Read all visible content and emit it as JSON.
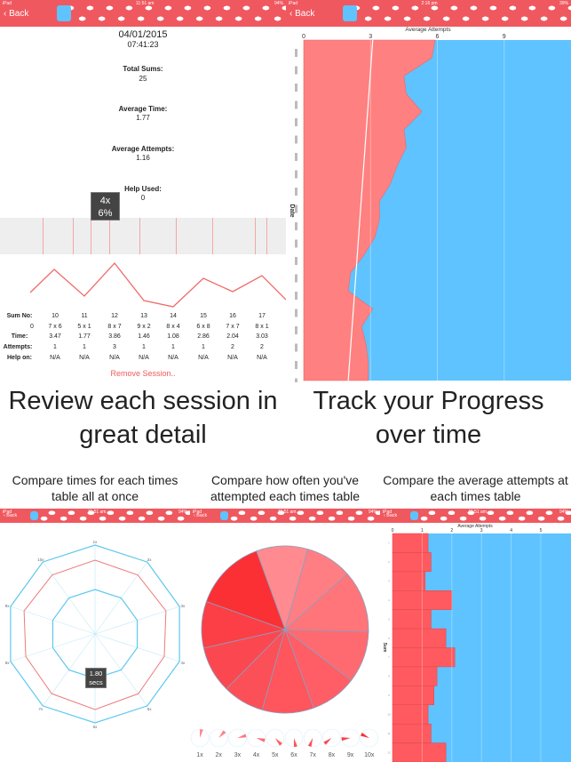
{
  "colors": {
    "nav": "#f0585f",
    "blue": "#5ec3ff",
    "red": "#ff7f7f",
    "bar_red": "#ff5a5f"
  },
  "nav": {
    "back_label": "Back",
    "status_left": "iPad",
    "time_1": "11:51 am",
    "battery_1": "94%",
    "time_2": "2:16 pm",
    "battery_2": "39%",
    "icon": "footprints-icon"
  },
  "session": {
    "date": "04/01/2015",
    "time": "07:41:23",
    "total_sums_label": "Total Sums:",
    "total_sums": "25",
    "avg_time_label": "Average Time:",
    "avg_time": "1.77",
    "avg_attempts_label": "Average Attempts:",
    "avg_attempts": "1.16",
    "help_used_label": "Help Used:",
    "help_used": "0",
    "tooltip_line1": "4x",
    "tooltip_line2": "6%",
    "row_labels": [
      "Sum No:",
      "Time:",
      "Attempts:",
      "Help on:"
    ],
    "row_extra": [
      "0",
      "'",
      ".",
      ""
    ],
    "columns": [
      {
        "no": "10",
        "sum": "7 x 6",
        "time": "3.47",
        "attempts": "1",
        "help": "N/A"
      },
      {
        "no": "11",
        "sum": "5 x 1",
        "time": "1.77",
        "attempts": "1",
        "help": "N/A"
      },
      {
        "no": "12",
        "sum": "8 x 7",
        "time": "3.86",
        "attempts": "3",
        "help": "N/A"
      },
      {
        "no": "13",
        "sum": "9 x 2",
        "time": "1.46",
        "attempts": "1",
        "help": "N/A"
      },
      {
        "no": "14",
        "sum": "8 x 4",
        "time": "1.08",
        "attempts": "1",
        "help": "N/A"
      },
      {
        "no": "15",
        "sum": "6 x 8",
        "time": "2.86",
        "attempts": "1",
        "help": "N/A"
      },
      {
        "no": "16",
        "sum": "7 x 7",
        "time": "2.04",
        "attempts": "2",
        "help": "N/A"
      },
      {
        "no": "17",
        "sum": "8 x 1",
        "time": "3.03",
        "attempts": "2",
        "help": "N/A"
      }
    ],
    "remove_label": "Remove Session.."
  },
  "captions": {
    "top_left": "Review each session in great detail",
    "top_right": "Track your Progress over time",
    "bottom_left": "Compare times for each times table all at once",
    "bottom_mid": "Compare how often you've attempted each times table",
    "bottom_right": "Compare the average attempts at each times table"
  },
  "chart_data": [
    {
      "type": "area",
      "title": "Average Attempts",
      "ylabel": "Date",
      "xlim": [
        0,
        12
      ],
      "xticks": [
        "0",
        "3",
        "6",
        "9"
      ],
      "values": [
        5.9,
        5.75,
        4.5,
        4.6,
        5.3,
        4.5,
        4.6,
        4.2,
        3.9,
        3.4,
        3.4,
        3.2,
        2.7,
        2.1,
        2.0,
        3.1,
        2.6,
        2.8,
        2.9,
        2.9
      ],
      "trend": [
        3.1,
        2.0
      ]
    },
    {
      "type": "radar",
      "categories": [
        "1x",
        "2x",
        "3x",
        "4x",
        "5x",
        "6x",
        "7x",
        "8x",
        "9x",
        "10x"
      ],
      "values": [
        0.83,
        0.82,
        0.84,
        0.82,
        0.83,
        0.85,
        0.83,
        0.82,
        0.84,
        0.82
      ],
      "tooltip": [
        "1.80",
        "secs"
      ]
    },
    {
      "type": "pie",
      "values": [
        10,
        9,
        12,
        10,
        9,
        10,
        8,
        9,
        9,
        14
      ],
      "small_labels": [
        "1x",
        "2x",
        "3x",
        "4x",
        "5x",
        "6x",
        "7x",
        "8x",
        "9x",
        "10x"
      ]
    },
    {
      "type": "bar",
      "title": "Average Attempts",
      "ylabel": "Sum",
      "xlim": [
        0,
        6
      ],
      "xticks": [
        "0",
        "1",
        "2",
        "3",
        "4",
        "5"
      ],
      "categories": [
        "1",
        "2",
        "3",
        "4",
        "5",
        "6",
        "7",
        "8",
        "9",
        "10",
        "11",
        "12"
      ],
      "values": [
        1.2,
        1.3,
        1.1,
        2.0,
        1.3,
        1.8,
        2.1,
        1.5,
        1.4,
        1.2,
        1.3,
        1.8
      ]
    }
  ]
}
